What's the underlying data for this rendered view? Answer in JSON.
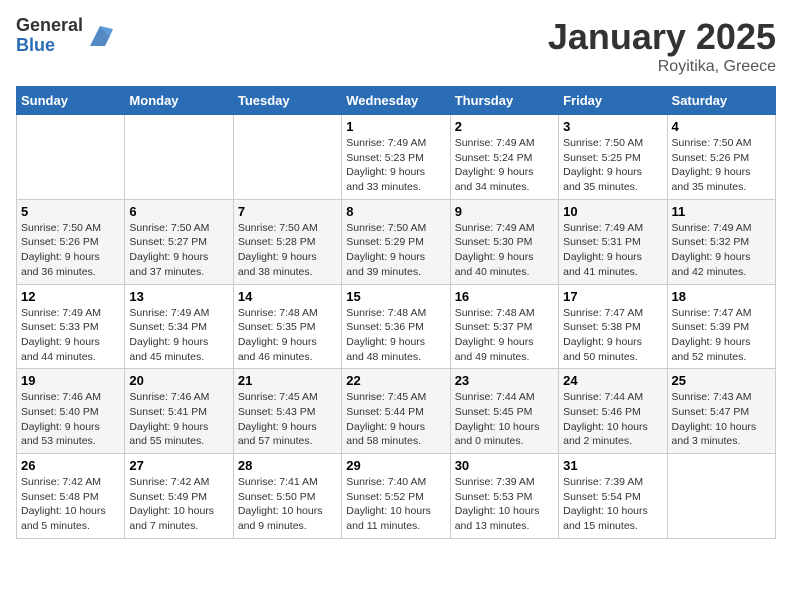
{
  "logo": {
    "general": "General",
    "blue": "Blue"
  },
  "title": "January 2025",
  "location": "Royitika, Greece",
  "days_header": [
    "Sunday",
    "Monday",
    "Tuesday",
    "Wednesday",
    "Thursday",
    "Friday",
    "Saturday"
  ],
  "weeks": [
    [
      {
        "day": "",
        "info": ""
      },
      {
        "day": "",
        "info": ""
      },
      {
        "day": "",
        "info": ""
      },
      {
        "day": "1",
        "info": "Sunrise: 7:49 AM\nSunset: 5:23 PM\nDaylight: 9 hours\nand 33 minutes."
      },
      {
        "day": "2",
        "info": "Sunrise: 7:49 AM\nSunset: 5:24 PM\nDaylight: 9 hours\nand 34 minutes."
      },
      {
        "day": "3",
        "info": "Sunrise: 7:50 AM\nSunset: 5:25 PM\nDaylight: 9 hours\nand 35 minutes."
      },
      {
        "day": "4",
        "info": "Sunrise: 7:50 AM\nSunset: 5:26 PM\nDaylight: 9 hours\nand 35 minutes."
      }
    ],
    [
      {
        "day": "5",
        "info": "Sunrise: 7:50 AM\nSunset: 5:26 PM\nDaylight: 9 hours\nand 36 minutes."
      },
      {
        "day": "6",
        "info": "Sunrise: 7:50 AM\nSunset: 5:27 PM\nDaylight: 9 hours\nand 37 minutes."
      },
      {
        "day": "7",
        "info": "Sunrise: 7:50 AM\nSunset: 5:28 PM\nDaylight: 9 hours\nand 38 minutes."
      },
      {
        "day": "8",
        "info": "Sunrise: 7:50 AM\nSunset: 5:29 PM\nDaylight: 9 hours\nand 39 minutes."
      },
      {
        "day": "9",
        "info": "Sunrise: 7:49 AM\nSunset: 5:30 PM\nDaylight: 9 hours\nand 40 minutes."
      },
      {
        "day": "10",
        "info": "Sunrise: 7:49 AM\nSunset: 5:31 PM\nDaylight: 9 hours\nand 41 minutes."
      },
      {
        "day": "11",
        "info": "Sunrise: 7:49 AM\nSunset: 5:32 PM\nDaylight: 9 hours\nand 42 minutes."
      }
    ],
    [
      {
        "day": "12",
        "info": "Sunrise: 7:49 AM\nSunset: 5:33 PM\nDaylight: 9 hours\nand 44 minutes."
      },
      {
        "day": "13",
        "info": "Sunrise: 7:49 AM\nSunset: 5:34 PM\nDaylight: 9 hours\nand 45 minutes."
      },
      {
        "day": "14",
        "info": "Sunrise: 7:48 AM\nSunset: 5:35 PM\nDaylight: 9 hours\nand 46 minutes."
      },
      {
        "day": "15",
        "info": "Sunrise: 7:48 AM\nSunset: 5:36 PM\nDaylight: 9 hours\nand 48 minutes."
      },
      {
        "day": "16",
        "info": "Sunrise: 7:48 AM\nSunset: 5:37 PM\nDaylight: 9 hours\nand 49 minutes."
      },
      {
        "day": "17",
        "info": "Sunrise: 7:47 AM\nSunset: 5:38 PM\nDaylight: 9 hours\nand 50 minutes."
      },
      {
        "day": "18",
        "info": "Sunrise: 7:47 AM\nSunset: 5:39 PM\nDaylight: 9 hours\nand 52 minutes."
      }
    ],
    [
      {
        "day": "19",
        "info": "Sunrise: 7:46 AM\nSunset: 5:40 PM\nDaylight: 9 hours\nand 53 minutes."
      },
      {
        "day": "20",
        "info": "Sunrise: 7:46 AM\nSunset: 5:41 PM\nDaylight: 9 hours\nand 55 minutes."
      },
      {
        "day": "21",
        "info": "Sunrise: 7:45 AM\nSunset: 5:43 PM\nDaylight: 9 hours\nand 57 minutes."
      },
      {
        "day": "22",
        "info": "Sunrise: 7:45 AM\nSunset: 5:44 PM\nDaylight: 9 hours\nand 58 minutes."
      },
      {
        "day": "23",
        "info": "Sunrise: 7:44 AM\nSunset: 5:45 PM\nDaylight: 10 hours\nand 0 minutes."
      },
      {
        "day": "24",
        "info": "Sunrise: 7:44 AM\nSunset: 5:46 PM\nDaylight: 10 hours\nand 2 minutes."
      },
      {
        "day": "25",
        "info": "Sunrise: 7:43 AM\nSunset: 5:47 PM\nDaylight: 10 hours\nand 3 minutes."
      }
    ],
    [
      {
        "day": "26",
        "info": "Sunrise: 7:42 AM\nSunset: 5:48 PM\nDaylight: 10 hours\nand 5 minutes."
      },
      {
        "day": "27",
        "info": "Sunrise: 7:42 AM\nSunset: 5:49 PM\nDaylight: 10 hours\nand 7 minutes."
      },
      {
        "day": "28",
        "info": "Sunrise: 7:41 AM\nSunset: 5:50 PM\nDaylight: 10 hours\nand 9 minutes."
      },
      {
        "day": "29",
        "info": "Sunrise: 7:40 AM\nSunset: 5:52 PM\nDaylight: 10 hours\nand 11 minutes."
      },
      {
        "day": "30",
        "info": "Sunrise: 7:39 AM\nSunset: 5:53 PM\nDaylight: 10 hours\nand 13 minutes."
      },
      {
        "day": "31",
        "info": "Sunrise: 7:39 AM\nSunset: 5:54 PM\nDaylight: 10 hours\nand 15 minutes."
      },
      {
        "day": "",
        "info": ""
      }
    ]
  ]
}
